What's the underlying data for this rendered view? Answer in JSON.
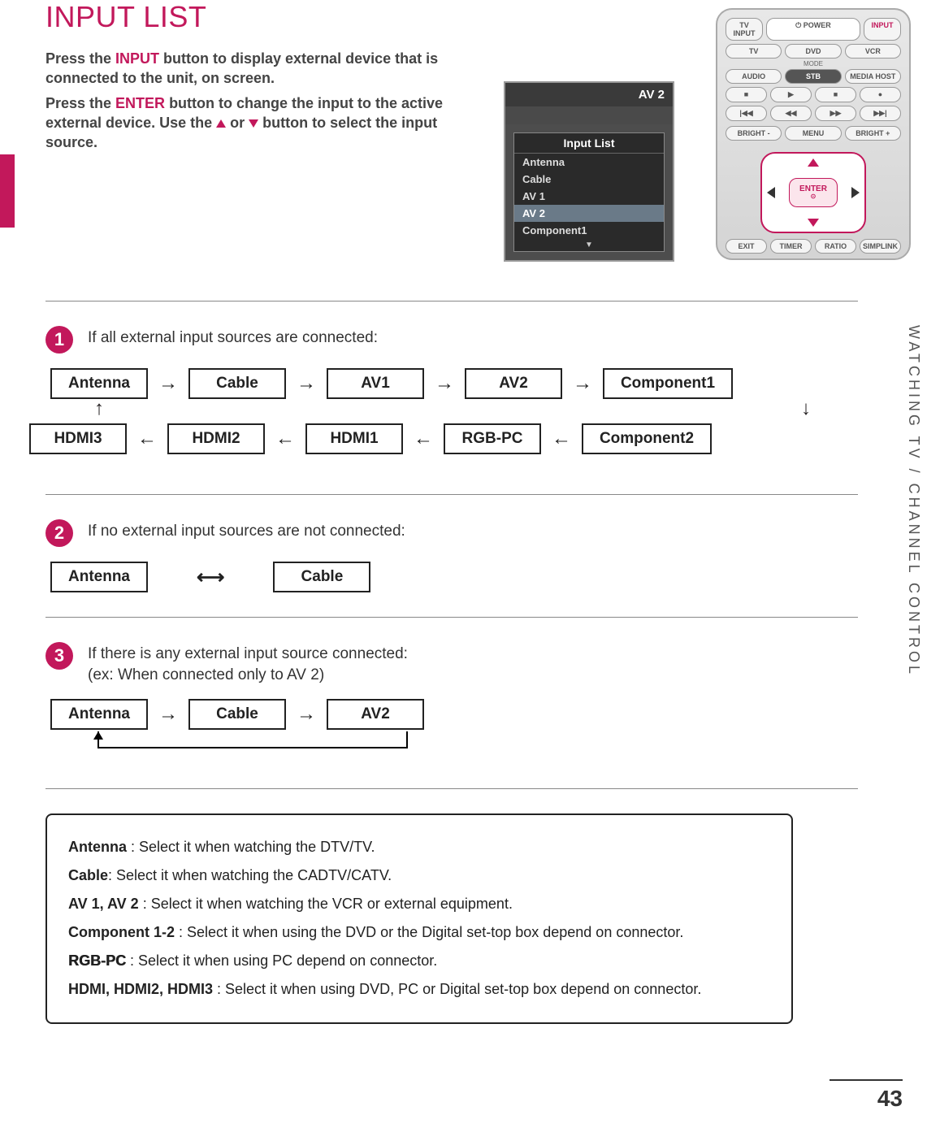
{
  "title": "INPUT LIST",
  "intro": {
    "p1_a": "Press the ",
    "p1_hl": "INPUT",
    "p1_b": " button to display external device that is connected to the unit, on screen.",
    "p2_a": "Press the ",
    "p2_hl": "ENTER",
    "p2_b": " button to change the input to the active external device. Use the ",
    "p2_c": " or ",
    "p2_d": " button to select the input source."
  },
  "osd": {
    "title": "AV 2",
    "dropdown_title": "Input List",
    "items": [
      "Antenna",
      "Cable",
      "AV 1",
      "AV 2",
      "Component1"
    ],
    "selected": "AV 2"
  },
  "remote": {
    "tv_input": "TV INPUT",
    "power": "POWER",
    "input": "INPUT",
    "row2": [
      "TV",
      "DVD",
      "VCR"
    ],
    "mode": "MODE",
    "row3": [
      "AUDIO",
      "STB",
      "MEDIA HOST"
    ],
    "transport": [
      "■",
      "▶",
      "■",
      "●"
    ],
    "seek": [
      "|◀◀",
      "◀◀",
      "▶▶",
      "▶▶|"
    ],
    "rowb": [
      "BRIGHT -",
      "MENU",
      "BRIGHT +"
    ],
    "enter": "ENTER",
    "rowc": [
      "EXIT",
      "TIMER",
      "RATIO",
      "SIMPLINK"
    ]
  },
  "sidebar": "WATCHING TV / CHANNEL CONTROL",
  "steps": {
    "s1": {
      "num": "1",
      "text": "If all external input sources are connected:",
      "row1": [
        "Antenna",
        "Cable",
        "AV1",
        "AV2",
        "Component1"
      ],
      "row2": [
        "HDMI3",
        "HDMI2",
        "HDMI1",
        "RGB-PC",
        "Component2"
      ]
    },
    "s2": {
      "num": "2",
      "text": "If no external input sources are not connected:",
      "items": [
        "Antenna",
        "Cable"
      ]
    },
    "s3": {
      "num": "3",
      "text1": "If there is any external input source connected:",
      "text2": "(ex: When connected only to AV 2)",
      "items": [
        "Antenna",
        "Cable",
        "AV2"
      ]
    }
  },
  "desc": {
    "d1": {
      "term": "Antenna",
      "text": " : Select it when watching the DTV/TV."
    },
    "d2": {
      "term": "Cable",
      "text": ": Select it when watching the CADTV/CATV."
    },
    "d3": {
      "term": "AV 1, AV 2",
      "text": " : Select it when watching the VCR or external equipment."
    },
    "d4": {
      "term": "Component 1-2",
      "text": " : Select it when using the DVD or the Digital set-top box depend on connector."
    },
    "d5": {
      "term": "RGB-PC",
      "text": " : Select it when using PC depend on connector."
    },
    "d6": {
      "term": "HDMI, HDMI2, HDMI3",
      "text": " : Select it when using DVD, PC or Digital set-top box depend on connector."
    }
  },
  "page": "43"
}
